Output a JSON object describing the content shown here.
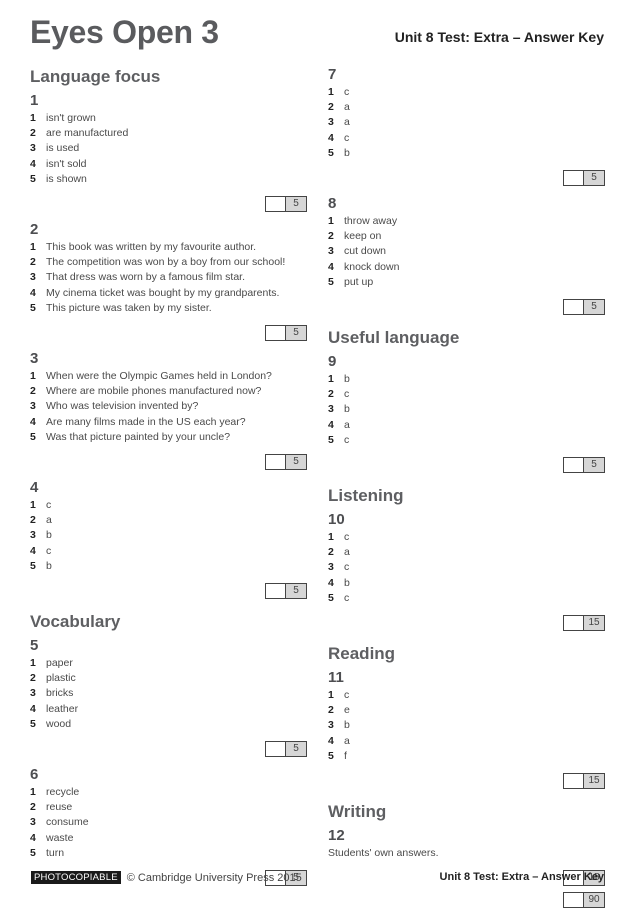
{
  "header": {
    "title": "Eyes Open 3",
    "subtitle": "Unit 8 Test: Extra – Answer Key"
  },
  "left_column": {
    "language_focus": {
      "title": "Language focus",
      "exercises": [
        {
          "number": "1",
          "score": "5",
          "answers": [
            "isn't grown",
            "are manufactured",
            "is used",
            "isn't sold",
            "is shown"
          ]
        },
        {
          "number": "2",
          "score": "5",
          "answers": [
            "This book was written by my favourite author.",
            "The competition was won by a boy from our school!",
            "That dress was worn by a famous film star.",
            "My cinema ticket was bought by my grandparents.",
            "This picture was taken by my sister."
          ]
        },
        {
          "number": "3",
          "score": "5",
          "answers": [
            "When were the Olympic Games held in London?",
            "Where are mobile phones manufactured now?",
            "Who was television invented by?",
            "Are many films made in the US each year?",
            "Was that picture painted by your uncle?"
          ]
        },
        {
          "number": "4",
          "score": "5",
          "answers": [
            "c",
            "a",
            "b",
            "c",
            "b"
          ]
        }
      ]
    },
    "vocabulary": {
      "title": "Vocabulary",
      "exercises": [
        {
          "number": "5",
          "score": "5",
          "answers": [
            "paper",
            "plastic",
            "bricks",
            "leather",
            "wood"
          ]
        },
        {
          "number": "6",
          "score": "5",
          "answers": [
            "recycle",
            "reuse",
            "consume",
            "waste",
            "turn"
          ]
        }
      ]
    }
  },
  "right_column": {
    "vocabulary_cont": {
      "exercises": [
        {
          "number": "7",
          "score": "5",
          "answers": [
            "c",
            "a",
            "a",
            "c",
            "b"
          ]
        },
        {
          "number": "8",
          "score": "5",
          "answers": [
            "throw away",
            "keep on",
            "cut down",
            "knock down",
            "put up"
          ]
        }
      ]
    },
    "useful_language": {
      "title": "Useful language",
      "exercises": [
        {
          "number": "9",
          "score": "5",
          "answers": [
            "b",
            "c",
            "b",
            "a",
            "c"
          ]
        }
      ]
    },
    "listening": {
      "title": "Listening",
      "exercises": [
        {
          "number": "10",
          "score": "15",
          "answers": [
            "c",
            "a",
            "c",
            "b",
            "c"
          ]
        }
      ]
    },
    "reading": {
      "title": "Reading",
      "exercises": [
        {
          "number": "11",
          "score": "15",
          "answers": [
            "c",
            "e",
            "b",
            "a",
            "f"
          ]
        }
      ]
    },
    "writing": {
      "title": "Writing",
      "exercises": [
        {
          "number": "12",
          "score": "15",
          "text": "Students' own answers."
        }
      ],
      "total_score": "90"
    }
  },
  "footer": {
    "badge": "PHOTOCOPIABLE",
    "copyright": "© Cambridge University Press 2015",
    "right_text": "Unit 8 Test: Extra – Answer Key"
  },
  "item_numbers": [
    "1",
    "2",
    "3",
    "4",
    "5"
  ]
}
